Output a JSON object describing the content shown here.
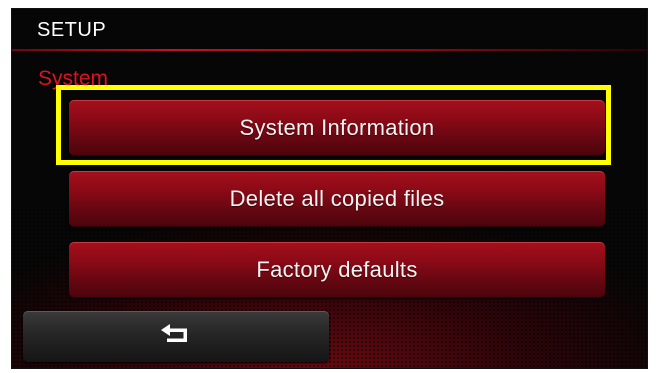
{
  "header": {
    "title": "SETUP"
  },
  "section": {
    "label": "System"
  },
  "menu": {
    "items": [
      {
        "label": "System Information"
      },
      {
        "label": "Delete all copied files"
      },
      {
        "label": "Factory defaults"
      }
    ]
  },
  "footer": {
    "back_icon": "return-arrow-icon"
  },
  "colors": {
    "accent_red": "#e0101e",
    "button_red": "#8a0a16",
    "highlight": "#ffff00",
    "background": "#060606"
  }
}
